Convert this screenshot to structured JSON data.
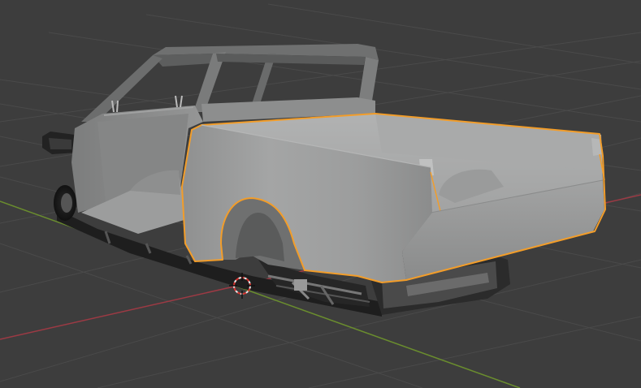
{
  "viewport": {
    "background": "#3d3d3d",
    "grid_color": "#4a4a4a",
    "x_axis_color": "#9c3a44",
    "y_axis_color": "#6a8d2e",
    "selection_outline_color": "#f29d2a"
  },
  "scene": {
    "object": "pickup-truck-body",
    "selected_part": "rear-bed",
    "cursor_icon": "3d-cursor-icon"
  }
}
